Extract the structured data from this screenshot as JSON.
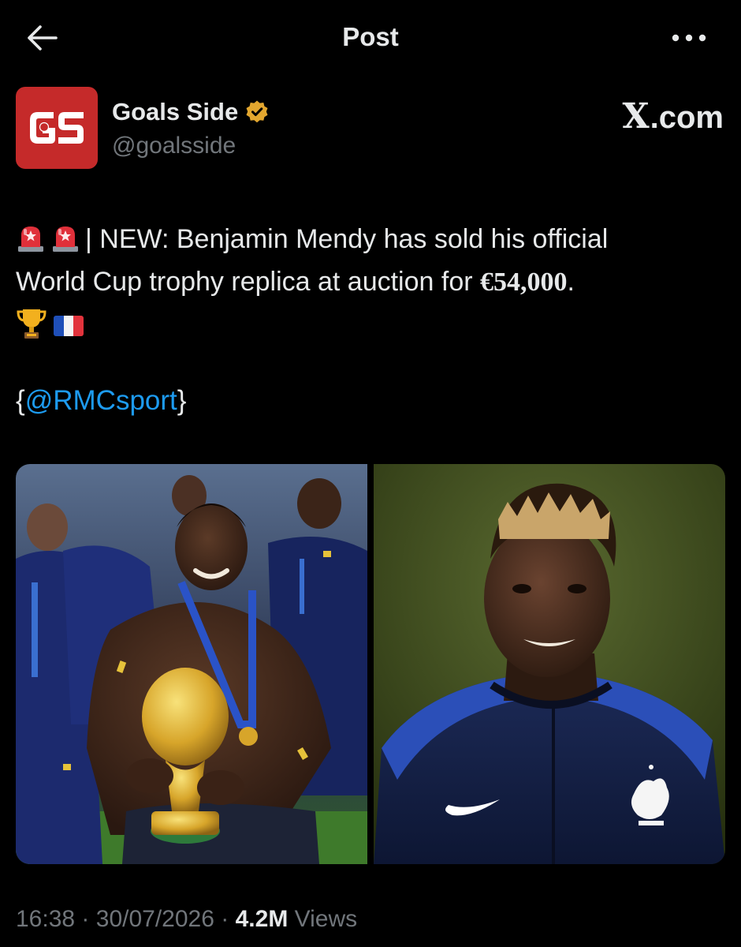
{
  "header": {
    "title": "Post"
  },
  "author": {
    "display_name": "Goals Side",
    "handle": "@goalsside",
    "verified": true,
    "avatar_text": "GS",
    "avatar_color": "#c52a2a",
    "verified_color": "#e3a72f"
  },
  "brand": {
    "x_glyph": "X",
    "suffix": ".com"
  },
  "tweet": {
    "emoji_prefix": [
      "police-light-emoji",
      "police-light-emoji"
    ],
    "line1": "| NEW: Benjamin Mendy has sold his official",
    "line2_a": "World Cup trophy replica at auction for ",
    "price": "€54,000",
    "line2_b": ".",
    "emoji_suffix": [
      "trophy-emoji",
      "france-flag-emoji"
    ],
    "source_open": "{",
    "source_mention": "@RMCsport",
    "source_close": "}"
  },
  "meta": {
    "time": "16:38",
    "date": "30/07/2026",
    "sep": "·",
    "views_count": "4.2M",
    "views_label": "Views"
  },
  "colors": {
    "background": "#000000",
    "text": "#e7e9ea",
    "secondary": "#71767b",
    "link": "#1d9bf0"
  }
}
